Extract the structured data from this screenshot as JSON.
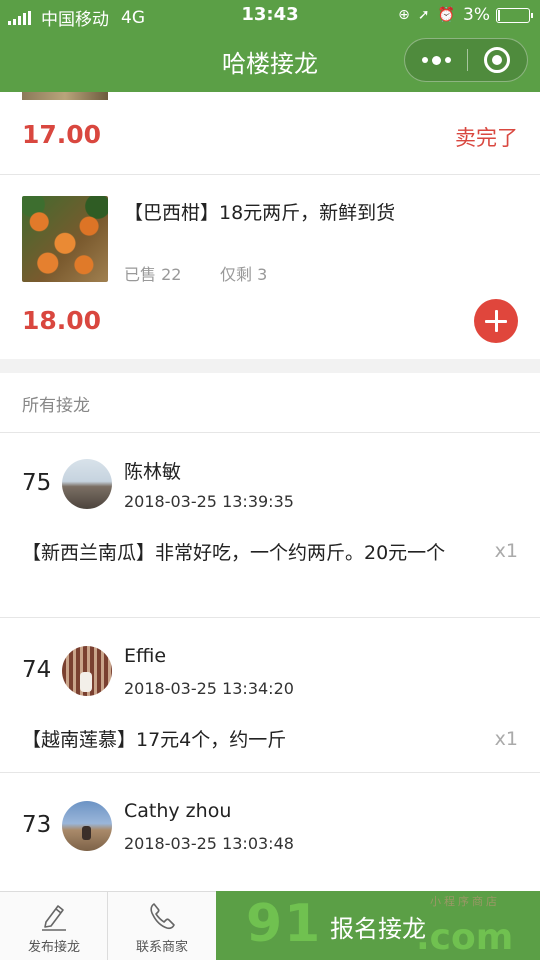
{
  "status_bar": {
    "carrier": "中国移动",
    "network": "4G",
    "time": "13:43",
    "battery": "3%"
  },
  "nav": {
    "title": "哈楼接龙"
  },
  "products": [
    {
      "price": "17.00",
      "status": "卖完了"
    },
    {
      "title": "【巴西柑】18元两斤，新鲜到货",
      "sold": "已售 22",
      "remaining": "仅剩 3",
      "price": "18.00"
    }
  ],
  "section_title": "所有接龙",
  "entries": [
    {
      "no": "75",
      "name": "陈林敏",
      "time": "2018-03-25 13:39:35",
      "text": "【新西兰南瓜】非常好吃，一个约两斤。20元一个",
      "qty": "x1"
    },
    {
      "no": "74",
      "name": "Effie",
      "time": "2018-03-25 13:34:20",
      "text": "【越南莲慕】17元4个，约一斤",
      "qty": "x1"
    },
    {
      "no": "73",
      "name": "Cathy zhou",
      "time": "2018-03-25 13:03:48"
    }
  ],
  "tabbar": {
    "publish": "发布接龙",
    "contact": "联系商家",
    "signup": "报名接龙"
  },
  "watermark": {
    "digits": "91",
    "suffix": ".com",
    "small": "小程序商店"
  },
  "colors": {
    "brand_green": "#5b9f46",
    "price_red": "#d9473f",
    "add_red": "#e0463c"
  }
}
